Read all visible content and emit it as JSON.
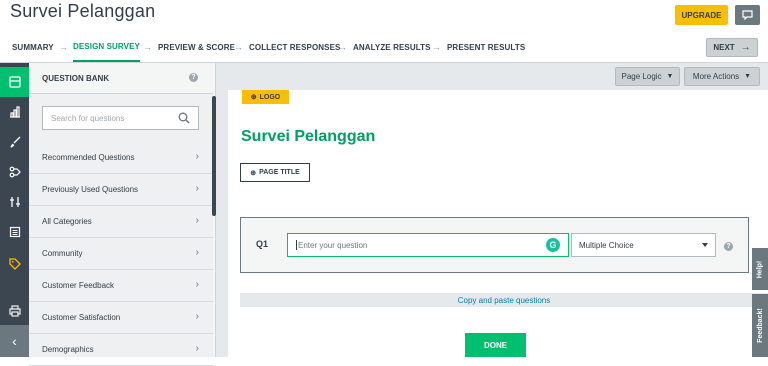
{
  "header": {
    "title": "Survei Pelanggan",
    "upgrade_label": "UPGRADE",
    "feedback_icon": "chat-bubble-icon"
  },
  "steps": [
    {
      "label": "SUMMARY"
    },
    {
      "label": "DESIGN SURVEY"
    },
    {
      "label": "PREVIEW & SCORE"
    },
    {
      "label": "COLLECT RESPONSES"
    },
    {
      "label": "ANALYZE RESULTS"
    },
    {
      "label": "PRESENT RESULTS"
    }
  ],
  "next_label": "NEXT",
  "rail": {
    "items": [
      "builder-icon",
      "analytics-icon",
      "brush-icon",
      "logic-icon",
      "options-icon",
      "page-icon",
      "tag-icon",
      "print-icon",
      "collapse-icon"
    ]
  },
  "question_bank": {
    "heading": "QUESTION BANK",
    "help": "?",
    "search_placeholder": "Search for questions",
    "items": [
      "Recommended Questions",
      "Previously Used Questions",
      "All Categories",
      "Community",
      "Customer Feedback",
      "Customer Satisfaction",
      "Demographics"
    ]
  },
  "toolbar": {
    "page_logic": "Page Logic",
    "more_actions": "More Actions"
  },
  "page": {
    "logo_label": "LOGO",
    "survey_title": "Survei Pelanggan",
    "page_title_label": "PAGE TITLE",
    "question": {
      "number": "Q1",
      "placeholder": "Enter your question",
      "grammarly": "G",
      "type": "Multiple Choice",
      "help": "?"
    },
    "copy_paste": "Copy and paste questions",
    "done_label": "DONE"
  },
  "side_tabs": {
    "help": "Help!",
    "feedback": "Feedback!"
  },
  "colors": {
    "brand_green": "#00bf6f",
    "upgrade_yellow": "#f9be00",
    "rail_dark": "#3b4650"
  }
}
